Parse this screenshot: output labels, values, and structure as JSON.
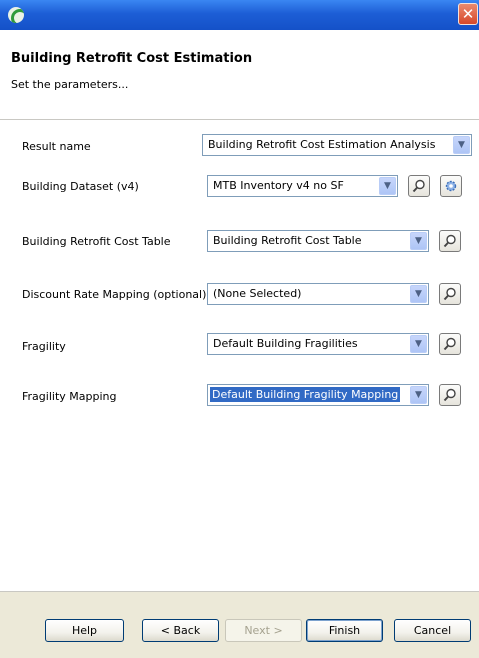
{
  "window": {
    "title": "",
    "close_glyph": "✕"
  },
  "header": {
    "title": "Building Retrofit Cost Estimation",
    "subtitle": "Set the parameters..."
  },
  "form": {
    "rows": [
      {
        "label": "Result name",
        "value": "Building Retrofit Cost Estimation Analysis"
      },
      {
        "label": "Building Dataset (v4)",
        "value": "MTB Inventory v4 no SF"
      },
      {
        "label": "Building Retrofit Cost Table",
        "value": "Building Retrofit Cost Table"
      },
      {
        "label": "Discount Rate Mapping (optional)",
        "value": "(None Selected)"
      },
      {
        "label": "Fragility",
        "value": "Default Building Fragilities"
      },
      {
        "label": "Fragility Mapping",
        "value": "Default Building Fragility Mapping"
      }
    ]
  },
  "buttons": {
    "help": "Help",
    "back": "< Back",
    "next": "Next >",
    "finish": "Finish",
    "cancel": "Cancel"
  },
  "colors": {
    "titlebar": "#1d5ed6",
    "selection": "#316ac5",
    "button_bar": "#ece9d8"
  }
}
